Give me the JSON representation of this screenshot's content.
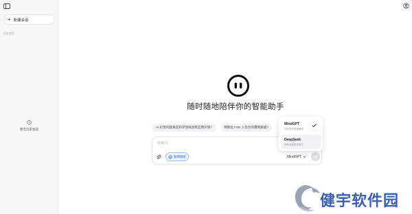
{
  "sidebar": {
    "new_chat_label": "新建会话",
    "history_title": "历史会话",
    "empty_history_text": "暂无历史会话"
  },
  "main": {
    "headline": "随时随地陪伴你的智能助手",
    "suggestions": [
      "AI 幻觉问题真在科学领域具有应用价值?",
      "特斯拉 FSD 入华为何遭到质疑?"
    ]
  },
  "input": {
    "placeholder": "给我问...",
    "web_search_label": "联网搜索",
    "model_selected": "MindGPT"
  },
  "model_dropdown": {
    "options": [
      {
        "name": "MindGPT",
        "desc": "问答带你快速解惑",
        "checked": true
      },
      {
        "name": "DeepSeek",
        "desc": "具有深度思考能力",
        "checked": false
      }
    ]
  },
  "watermark": {
    "text": "健宇软件园"
  },
  "colors": {
    "accent": "#2f6fe0",
    "brand_watermark": "#3a5fb5"
  },
  "icons": [
    "sidebar-toggle-icon",
    "plus-icon",
    "clock-icon",
    "settings-icon",
    "logo-face-icon",
    "attach-icon",
    "globe-icon",
    "chevron-down-icon",
    "send-icon",
    "check-icon"
  ]
}
